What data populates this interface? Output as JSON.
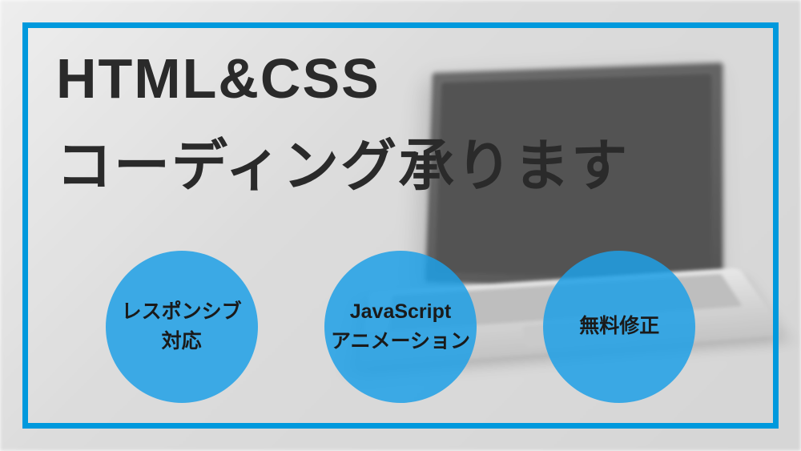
{
  "heading": {
    "line1": "HTML&CSS",
    "line2": "コーディング承ります"
  },
  "badges": [
    {
      "text": "レスポンシブ\n対応"
    },
    {
      "text": "JavaScript\nアニメーション"
    },
    {
      "text": "無料修正"
    }
  ],
  "colors": {
    "accent": "#0099dd",
    "badge": "rgba(30, 160, 230, 0.85)"
  }
}
